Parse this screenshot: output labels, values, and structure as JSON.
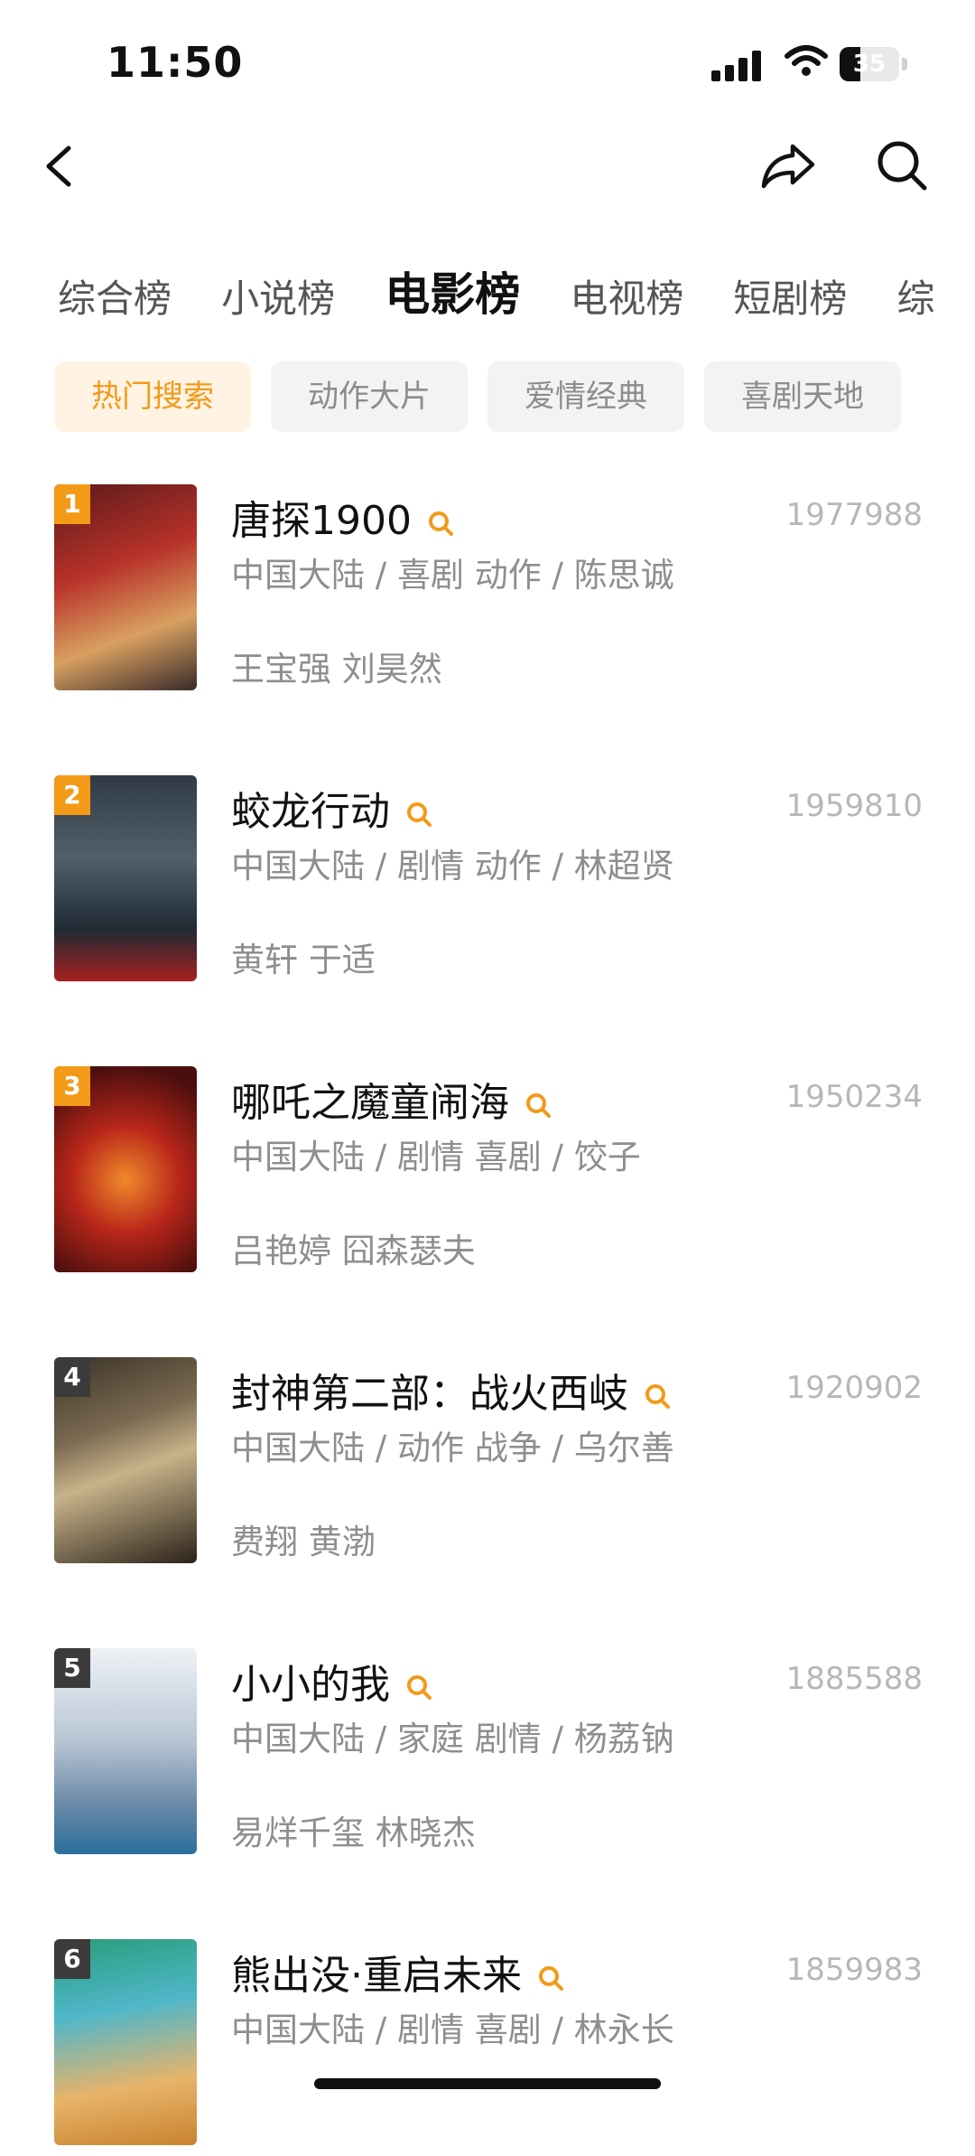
{
  "status": {
    "time": "11:50",
    "battery": "35",
    "battery_level": 0.35
  },
  "tabs": [
    {
      "label": "综合榜",
      "active": false
    },
    {
      "label": "小说榜",
      "active": false
    },
    {
      "label": "电影榜",
      "active": true
    },
    {
      "label": "电视榜",
      "active": false
    },
    {
      "label": "短剧榜",
      "active": false
    },
    {
      "label": "综",
      "active": false
    }
  ],
  "chips": [
    {
      "label": "热门搜索",
      "active": true
    },
    {
      "label": "动作大片",
      "active": false
    },
    {
      "label": "爱情经典",
      "active": false
    },
    {
      "label": "喜剧天地",
      "active": false
    }
  ],
  "items": [
    {
      "rank": "1",
      "title": "唐探1900",
      "count": "1977988",
      "meta": "中国大陆 / 喜剧 动作 / 陈思诚",
      "cast": "王宝强 刘昊然",
      "rank_color": "#f39a19"
    },
    {
      "rank": "2",
      "title": "蛟龙行动",
      "count": "1959810",
      "meta": "中国大陆 / 剧情 动作 / 林超贤",
      "cast": "黄轩 于适",
      "rank_color": "#f39a19"
    },
    {
      "rank": "3",
      "title": "哪吒之魔童闹海",
      "count": "1950234",
      "meta": "中国大陆 / 剧情 喜剧 / 饺子",
      "cast": "吕艳婷 囧森瑟夫",
      "rank_color": "#f39a19"
    },
    {
      "rank": "4",
      "title": "封神第二部：战火西岐",
      "count": "1920902",
      "meta": "中国大陆 / 动作 战争 / 乌尔善",
      "cast": "费翔 黄渤",
      "rank_color": "#3b3b3b"
    },
    {
      "rank": "5",
      "title": "小小的我",
      "count": "1885588",
      "meta": "中国大陆 / 家庭 剧情 / 杨荔钠",
      "cast": "易烊千玺 林晓杰",
      "rank_color": "#3b3b3b"
    },
    {
      "rank": "6",
      "title": "熊出没·重启未来",
      "count": "1859983",
      "meta": "中国大陆 / 剧情 喜剧 / 林永长",
      "cast": "",
      "rank_color": "#3b3b3b"
    }
  ],
  "colors": {
    "accent": "#f39a19",
    "accent_bg": "#fff3e3"
  },
  "icons": {
    "back": "chevron-left-icon",
    "share": "share-icon",
    "search": "search-icon",
    "item_search": "search-icon"
  }
}
